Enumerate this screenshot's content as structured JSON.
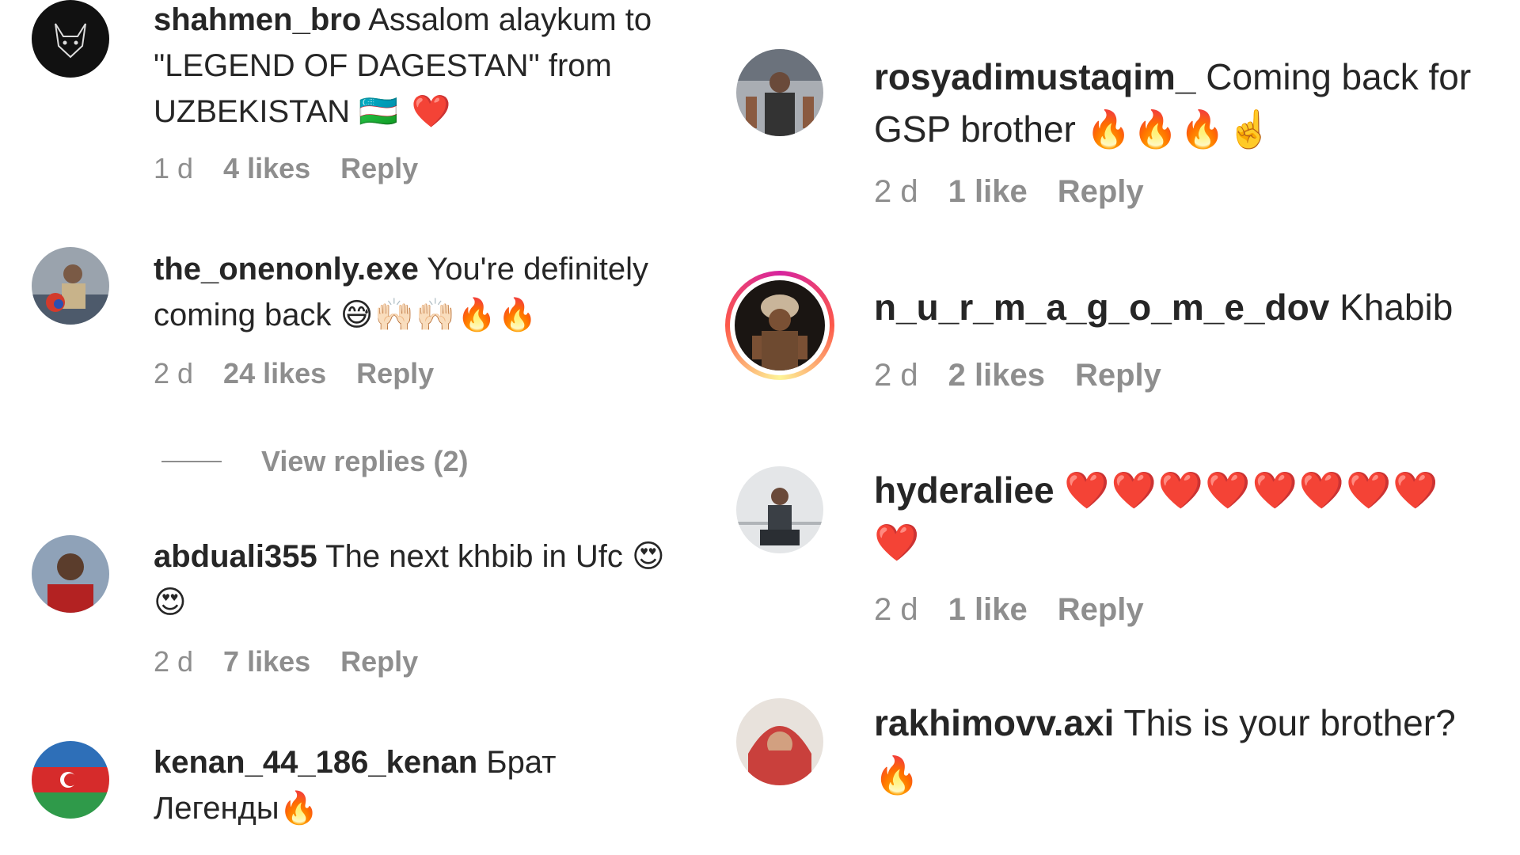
{
  "left_column": [
    {
      "username": "shahmen_bro",
      "text_lines": [
        "Assalom alaykum to",
        "\"LEGEND OF DAGESTAN\" from",
        "UZBEKISTAN"
      ],
      "emoji": "🇺🇿 ❤️",
      "time": "1 d",
      "likes": "4 likes",
      "reply": "Reply"
    },
    {
      "username": "the_onenonly.exe",
      "text_lines": [
        "You're definitely",
        "coming back"
      ],
      "emoji": "😅🙌🏻🙌🏻🔥🔥",
      "time": "2 d",
      "likes": "24 likes",
      "reply": "Reply"
    },
    {
      "username": "abduali355",
      "text_lines": [
        "The next khbib in Ufc"
      ],
      "emoji": "😍",
      "emoji2": "😍",
      "time": "2 d",
      "likes": "7 likes",
      "reply": "Reply"
    },
    {
      "username": "kenan_44_186_kenan",
      "text_lines": [
        "Брат",
        "Легенды"
      ],
      "emoji": "🔥"
    }
  ],
  "view_replies": "View replies (2)",
  "right_column": [
    {
      "username": "rosyadimustaqim_",
      "text_lines": [
        "Coming back for",
        "GSP brother"
      ],
      "emoji": "🔥🔥🔥☝️",
      "time": "2 d",
      "likes": "1 like",
      "reply": "Reply"
    },
    {
      "username": "n_u_r_m_a_g_o_m_e_dov",
      "text_lines": [
        "Khabib"
      ],
      "time": "2 d",
      "likes": "2 likes",
      "reply": "Reply"
    },
    {
      "username": "hyderaliee",
      "emoji": "❤️❤️❤️❤️❤️❤️❤️❤️",
      "emoji2": "❤️",
      "time": "2 d",
      "likes": "1 like",
      "reply": "Reply"
    },
    {
      "username": "rakhimovv.axi",
      "text_lines": [
        "This is your brother?"
      ],
      "emoji": "🔥"
    }
  ],
  "colors": {
    "text": "#262626",
    "meta": "#8e8e8e",
    "story_ring": "#d6249f"
  }
}
